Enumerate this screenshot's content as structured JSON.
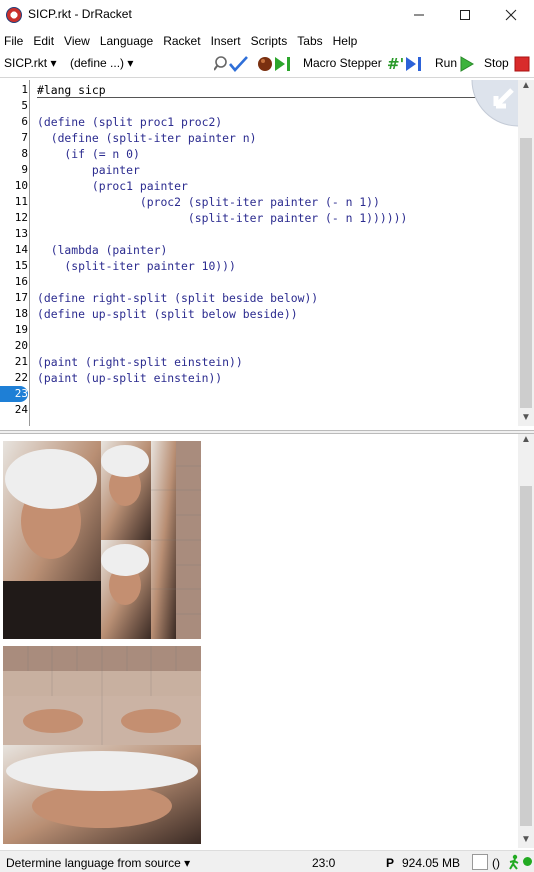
{
  "window": {
    "title": "SICP.rkt - DrRacket",
    "controls": [
      "minimize",
      "maximize",
      "close"
    ]
  },
  "menubar": {
    "items": [
      {
        "label": "File",
        "key": "F"
      },
      {
        "label": "Edit",
        "key": "E"
      },
      {
        "label": "View",
        "key": "V"
      },
      {
        "label": "Language",
        "key": "L"
      },
      {
        "label": "Racket",
        "key": "c"
      },
      {
        "label": "Insert",
        "key": "I"
      },
      {
        "label": "Scripts",
        "key": "S"
      },
      {
        "label": "Tabs",
        "key": "T"
      },
      {
        "label": "Help",
        "key": "H"
      }
    ]
  },
  "toolbar": {
    "file_menu": "SICP.rkt",
    "define_menu": "(define ...)",
    "macro_stepper": "Macro Stepper",
    "run": "Run",
    "stop": "Stop",
    "colors": {
      "run": "#3cb33c",
      "stop": "#d92b2b"
    }
  },
  "editor": {
    "lines": [
      {
        "num": "1",
        "text": "#lang sicp"
      },
      {
        "num": "5",
        "text": ""
      },
      {
        "num": "6",
        "text": "(define (split proc1 proc2)"
      },
      {
        "num": "7",
        "text": "  (define (split-iter painter n)"
      },
      {
        "num": "8",
        "text": "    (if (= n 0)"
      },
      {
        "num": "9",
        "text": "        painter"
      },
      {
        "num": "10",
        "text": "        (proc1 painter"
      },
      {
        "num": "11",
        "text": "               (proc2 (split-iter painter (- n 1))"
      },
      {
        "num": "12",
        "text": "                      (split-iter painter (- n 1))))))"
      },
      {
        "num": "13",
        "text": ""
      },
      {
        "num": "14",
        "text": "  (lambda (painter)"
      },
      {
        "num": "15",
        "text": "    (split-iter painter 10)))"
      },
      {
        "num": "16",
        "text": ""
      },
      {
        "num": "17",
        "text": "(define right-split (split beside below))"
      },
      {
        "num": "18",
        "text": "(define up-split (split below beside))"
      },
      {
        "num": "19",
        "text": ""
      },
      {
        "num": "20",
        "text": ""
      },
      {
        "num": "21",
        "text": "(paint (right-split einstein))"
      },
      {
        "num": "22",
        "text": "(paint (up-split einstein))"
      },
      {
        "num": "23",
        "text": ""
      },
      {
        "num": "24",
        "text": ""
      }
    ],
    "current_line": "23"
  },
  "interactions": {
    "images": [
      "right-split einstein painting",
      "up-split einstein painting"
    ]
  },
  "statusbar": {
    "language": "Determine language from source",
    "position": "23:0",
    "memory_flag": "P",
    "memory": "924.05 MB",
    "paren": "()",
    "indicator_color": "#22aa22"
  }
}
